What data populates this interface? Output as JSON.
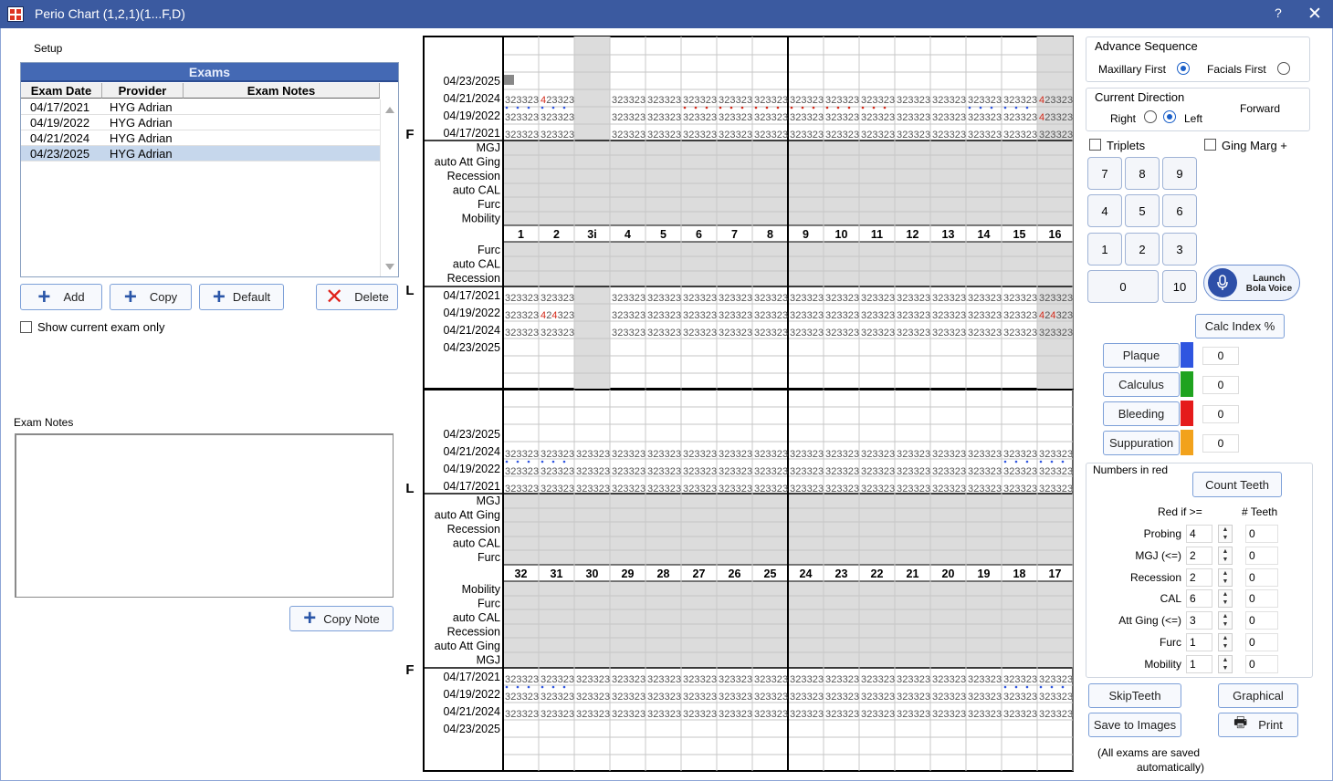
{
  "window": {
    "title": "Perio Chart (1,2,1)(1...F,D)",
    "help": "?",
    "close": "✕"
  },
  "setup": "Setup",
  "exams": {
    "title": "Exams",
    "columns": [
      "Exam Date",
      "Provider",
      "Exam Notes"
    ],
    "rows": [
      {
        "date": "04/17/2021",
        "provider": "HYG Adrian",
        "notes": ""
      },
      {
        "date": "04/19/2022",
        "provider": "HYG Adrian",
        "notes": ""
      },
      {
        "date": "04/21/2024",
        "provider": "HYG Adrian",
        "notes": ""
      },
      {
        "date": "04/23/2025",
        "provider": "HYG Adrian",
        "notes": ""
      }
    ],
    "selected_index": 3
  },
  "buttons": {
    "add": "Add",
    "copy": "Copy",
    "default": "Default",
    "delete": "Delete",
    "copy_note": "Copy Note",
    "calc_index": "Calc Index %",
    "count_teeth": "Count Teeth",
    "skip_teeth": "SkipTeeth",
    "graphical": "Graphical",
    "save_images": "Save to Images",
    "print": "Print",
    "launch_voice_1": "Launch",
    "launch_voice_2": "Bola Voice"
  },
  "show_current_only": "Show current exam only",
  "exam_notes_label": "Exam Notes",
  "advance": {
    "title": "Advance Sequence",
    "opt1": "Maxillary First",
    "opt2": "Facials First",
    "selected": "Maxillary First"
  },
  "direction": {
    "title": "Current Direction",
    "right": "Right",
    "left": "Left",
    "selected": "Left",
    "value": "Forward"
  },
  "triplets": "Triplets",
  "ging_marg": "Ging Marg +",
  "keypad": [
    "7",
    "8",
    "9",
    "4",
    "5",
    "6",
    "1",
    "2",
    "3",
    "0",
    "10"
  ],
  "indices": [
    {
      "label": "Plaque",
      "color": "#2f55e0",
      "value": "0"
    },
    {
      "label": "Calculus",
      "color": "#1fa31f",
      "value": "0"
    },
    {
      "label": "Bleeding",
      "color": "#e51b1b",
      "value": "0"
    },
    {
      "label": "Suppuration",
      "color": "#f2a21c",
      "value": "0"
    }
  ],
  "red_settings": {
    "title": "Numbers in red",
    "red_if": "Red if >=",
    "teeth_col": "# Teeth",
    "rows": [
      {
        "label": "Probing",
        "value": "4",
        "count": "0"
      },
      {
        "label": "MGJ (<=)",
        "value": "2",
        "count": "0"
      },
      {
        "label": "Recession",
        "value": "2",
        "count": "0"
      },
      {
        "label": "CAL",
        "value": "6",
        "count": "0"
      },
      {
        "label": "Att Ging (<=)",
        "value": "3",
        "count": "0"
      },
      {
        "label": "Furc",
        "value": "1",
        "count": "0"
      },
      {
        "label": "Mobility",
        "value": "1",
        "count": "0"
      }
    ]
  },
  "autosave_note_1": "(All exams are saved",
  "autosave_note_2": "automatically)",
  "chart": {
    "upper_teeth": [
      "1",
      "2",
      "3i",
      "4",
      "5",
      "6",
      "7",
      "8",
      "9",
      "10",
      "11",
      "12",
      "13",
      "14",
      "15",
      "16"
    ],
    "lower_teeth": [
      "32",
      "31",
      "30",
      "29",
      "28",
      "27",
      "26",
      "25",
      "24",
      "23",
      "22",
      "21",
      "20",
      "19",
      "18",
      "17"
    ],
    "side_labels": [
      "F",
      "L",
      "L",
      "F"
    ],
    "upper_facial_dates": [
      "04/23/2025",
      "04/21/2024",
      "04/19/2022",
      "04/17/2021"
    ],
    "upper_facial_rows": [
      "MGJ",
      "auto Att Ging",
      "Recession",
      "auto CAL",
      "Furc",
      "Mobility"
    ],
    "upper_lingual_rows": [
      "Furc",
      "auto CAL",
      "Recession"
    ],
    "upper_lingual_dates": [
      "04/17/2021",
      "04/19/2022",
      "04/21/2024",
      "04/23/2025"
    ],
    "lower_lingual_dates": [
      "04/23/2025",
      "04/21/2024",
      "04/19/2022",
      "04/17/2021"
    ],
    "lower_lingual_rows": [
      "MGJ",
      "auto Att Ging",
      "Recession",
      "auto CAL",
      "Furc"
    ],
    "lower_facial_rows": [
      "Mobility",
      "Furc",
      "auto CAL",
      "Recession",
      "auto Att Ging",
      "MGJ"
    ],
    "lower_facial_dates": [
      "04/17/2021",
      "04/19/2022",
      "04/21/2024",
      "04/23/2025"
    ],
    "default_reading": "323",
    "red_sites": {
      "uf-1-1": "4",
      "uf-1-15": "4",
      "uf-2-2": "4",
      "uf-2-15": "43",
      "ul-1-1": "434",
      "ul-1-15": "434"
    }
  }
}
